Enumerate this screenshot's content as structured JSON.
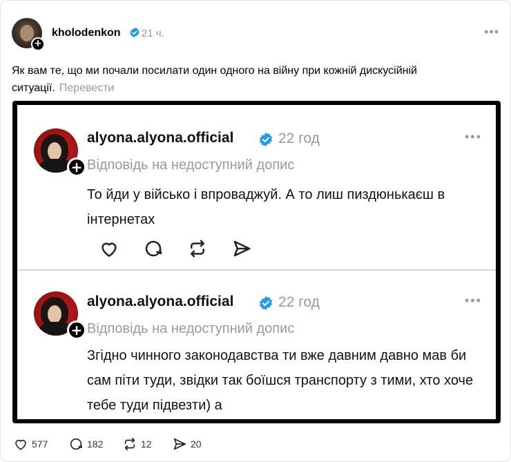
{
  "post": {
    "username": "kholodenkon",
    "time": "21 ч.",
    "text": "Як вам те, що ми почали посилати один одного на війну при кожній дискусійній ситуації.",
    "translate_label": "Перевести",
    "more_icon": "more-icon"
  },
  "embed": {
    "replies": [
      {
        "username": "alyona.alyona.official",
        "time": "22 год",
        "subtitle": "Відповідь на недоступний допис",
        "text": "То йди у військо і впроваджуй. А то лиш пиздюнькаєш в інтернетах"
      },
      {
        "username": "alyona.alyona.official",
        "time": "22 год",
        "subtitle": "Відповідь на недоступний допис",
        "text": "Згідно чинного законодавства ти вже давним давно мав би сам піти туди, звідки так боїшся транспорту з тими, хто хоче тебе туди підвезти) а"
      }
    ]
  },
  "footer": {
    "likes": "577",
    "comments": "182",
    "reposts": "12",
    "shares": "20"
  },
  "colors": {
    "verified": "#1d9bf0",
    "muted": "#999999",
    "avatar_red": "#b51a1a"
  }
}
